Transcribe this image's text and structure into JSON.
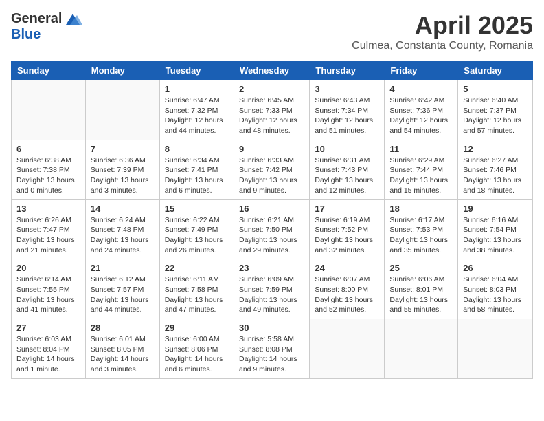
{
  "header": {
    "logo_general": "General",
    "logo_blue": "Blue",
    "month": "April 2025",
    "location": "Culmea, Constanta County, Romania"
  },
  "weekdays": [
    "Sunday",
    "Monday",
    "Tuesday",
    "Wednesday",
    "Thursday",
    "Friday",
    "Saturday"
  ],
  "weeks": [
    [
      {
        "day": "",
        "info": ""
      },
      {
        "day": "",
        "info": ""
      },
      {
        "day": "1",
        "info": "Sunrise: 6:47 AM\nSunset: 7:32 PM\nDaylight: 12 hours\nand 44 minutes."
      },
      {
        "day": "2",
        "info": "Sunrise: 6:45 AM\nSunset: 7:33 PM\nDaylight: 12 hours\nand 48 minutes."
      },
      {
        "day": "3",
        "info": "Sunrise: 6:43 AM\nSunset: 7:34 PM\nDaylight: 12 hours\nand 51 minutes."
      },
      {
        "day": "4",
        "info": "Sunrise: 6:42 AM\nSunset: 7:36 PM\nDaylight: 12 hours\nand 54 minutes."
      },
      {
        "day": "5",
        "info": "Sunrise: 6:40 AM\nSunset: 7:37 PM\nDaylight: 12 hours\nand 57 minutes."
      }
    ],
    [
      {
        "day": "6",
        "info": "Sunrise: 6:38 AM\nSunset: 7:38 PM\nDaylight: 13 hours\nand 0 minutes."
      },
      {
        "day": "7",
        "info": "Sunrise: 6:36 AM\nSunset: 7:39 PM\nDaylight: 13 hours\nand 3 minutes."
      },
      {
        "day": "8",
        "info": "Sunrise: 6:34 AM\nSunset: 7:41 PM\nDaylight: 13 hours\nand 6 minutes."
      },
      {
        "day": "9",
        "info": "Sunrise: 6:33 AM\nSunset: 7:42 PM\nDaylight: 13 hours\nand 9 minutes."
      },
      {
        "day": "10",
        "info": "Sunrise: 6:31 AM\nSunset: 7:43 PM\nDaylight: 13 hours\nand 12 minutes."
      },
      {
        "day": "11",
        "info": "Sunrise: 6:29 AM\nSunset: 7:44 PM\nDaylight: 13 hours\nand 15 minutes."
      },
      {
        "day": "12",
        "info": "Sunrise: 6:27 AM\nSunset: 7:46 PM\nDaylight: 13 hours\nand 18 minutes."
      }
    ],
    [
      {
        "day": "13",
        "info": "Sunrise: 6:26 AM\nSunset: 7:47 PM\nDaylight: 13 hours\nand 21 minutes."
      },
      {
        "day": "14",
        "info": "Sunrise: 6:24 AM\nSunset: 7:48 PM\nDaylight: 13 hours\nand 24 minutes."
      },
      {
        "day": "15",
        "info": "Sunrise: 6:22 AM\nSunset: 7:49 PM\nDaylight: 13 hours\nand 26 minutes."
      },
      {
        "day": "16",
        "info": "Sunrise: 6:21 AM\nSunset: 7:50 PM\nDaylight: 13 hours\nand 29 minutes."
      },
      {
        "day": "17",
        "info": "Sunrise: 6:19 AM\nSunset: 7:52 PM\nDaylight: 13 hours\nand 32 minutes."
      },
      {
        "day": "18",
        "info": "Sunrise: 6:17 AM\nSunset: 7:53 PM\nDaylight: 13 hours\nand 35 minutes."
      },
      {
        "day": "19",
        "info": "Sunrise: 6:16 AM\nSunset: 7:54 PM\nDaylight: 13 hours\nand 38 minutes."
      }
    ],
    [
      {
        "day": "20",
        "info": "Sunrise: 6:14 AM\nSunset: 7:55 PM\nDaylight: 13 hours\nand 41 minutes."
      },
      {
        "day": "21",
        "info": "Sunrise: 6:12 AM\nSunset: 7:57 PM\nDaylight: 13 hours\nand 44 minutes."
      },
      {
        "day": "22",
        "info": "Sunrise: 6:11 AM\nSunset: 7:58 PM\nDaylight: 13 hours\nand 47 minutes."
      },
      {
        "day": "23",
        "info": "Sunrise: 6:09 AM\nSunset: 7:59 PM\nDaylight: 13 hours\nand 49 minutes."
      },
      {
        "day": "24",
        "info": "Sunrise: 6:07 AM\nSunset: 8:00 PM\nDaylight: 13 hours\nand 52 minutes."
      },
      {
        "day": "25",
        "info": "Sunrise: 6:06 AM\nSunset: 8:01 PM\nDaylight: 13 hours\nand 55 minutes."
      },
      {
        "day": "26",
        "info": "Sunrise: 6:04 AM\nSunset: 8:03 PM\nDaylight: 13 hours\nand 58 minutes."
      }
    ],
    [
      {
        "day": "27",
        "info": "Sunrise: 6:03 AM\nSunset: 8:04 PM\nDaylight: 14 hours\nand 1 minute."
      },
      {
        "day": "28",
        "info": "Sunrise: 6:01 AM\nSunset: 8:05 PM\nDaylight: 14 hours\nand 3 minutes."
      },
      {
        "day": "29",
        "info": "Sunrise: 6:00 AM\nSunset: 8:06 PM\nDaylight: 14 hours\nand 6 minutes."
      },
      {
        "day": "30",
        "info": "Sunrise: 5:58 AM\nSunset: 8:08 PM\nDaylight: 14 hours\nand 9 minutes."
      },
      {
        "day": "",
        "info": ""
      },
      {
        "day": "",
        "info": ""
      },
      {
        "day": "",
        "info": ""
      }
    ]
  ]
}
